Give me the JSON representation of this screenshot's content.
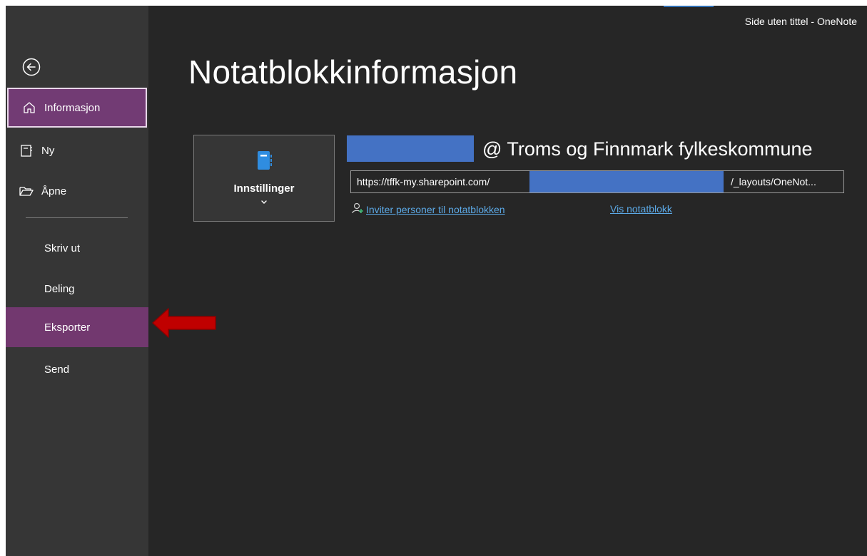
{
  "window": {
    "title": "Side uten tittel  -  OneNote"
  },
  "colors": {
    "background": "#262626",
    "sidebar": "#363636",
    "accent": "#723b74",
    "link": "#5ca9e6",
    "redaction": "#4472c4",
    "annotation_arrow": "#c00000"
  },
  "sidebar": {
    "back_icon": "back-arrow-icon",
    "items": [
      {
        "label": "Informasjon",
        "icon": "home-icon",
        "state": "active"
      },
      {
        "label": "Ny",
        "icon": "new-notebook-icon"
      },
      {
        "label": "Åpne",
        "icon": "open-folder-icon"
      },
      {
        "label": "Skriv ut"
      },
      {
        "label": "Deling"
      },
      {
        "label": "Eksporter",
        "state": "highlighted"
      },
      {
        "label": "Send"
      }
    ]
  },
  "main": {
    "heading": "Notatblokkinformasjon",
    "settings_button": {
      "label": "Innstillinger",
      "icon": "notebook-icon"
    },
    "notebook": {
      "owner": "@ Troms og Finnmark fylkeskommune",
      "url_prefix": "https://tffk-my.sharepoint.com/",
      "url_suffix": "/_layouts/OneNot..."
    },
    "invite_link": "Inviter personer til notatblokken",
    "view_link": "Vis notatblokk"
  }
}
